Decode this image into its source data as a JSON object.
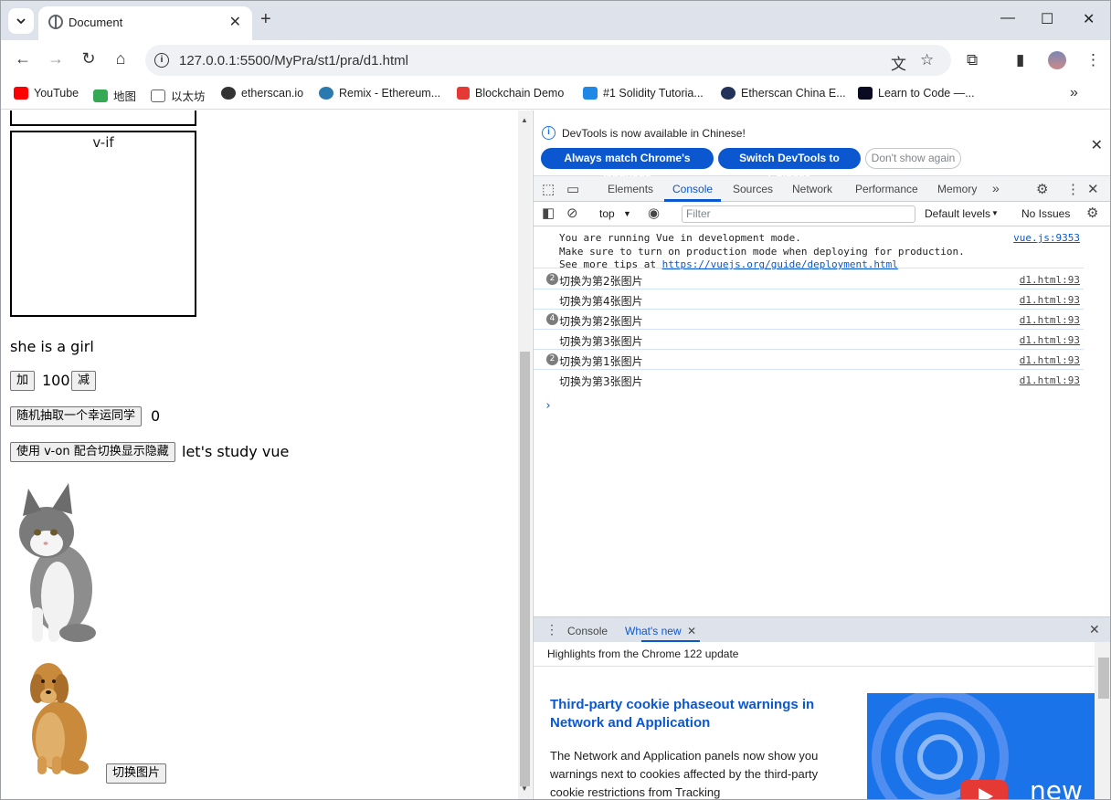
{
  "browser": {
    "tab_title": "Document",
    "url": "127.0.0.1:5500/MyPra/st1/pra/d1.html",
    "bookmarks": [
      {
        "label": "YouTube",
        "color": "#ff0000"
      },
      {
        "label": "地图",
        "color": "#34a853"
      },
      {
        "label": "以太坊",
        "color": "#5f6368"
      },
      {
        "label": "etherscan.io",
        "color": "#333333"
      },
      {
        "label": "Remix - Ethereum...",
        "color": "#2a7ab0"
      },
      {
        "label": "Blockchain Demo",
        "color": "#e53935"
      },
      {
        "label": "#1 Solidity Tutoria...",
        "color": "#1e88e5"
      },
      {
        "label": "Etherscan China E...",
        "color": "#21325b"
      },
      {
        "label": "Learn to Code —...",
        "color": "#0a0a23"
      }
    ]
  },
  "page": {
    "vif_label": "v-if",
    "she_text": "she is a girl",
    "add_btn": "加",
    "counter": "100",
    "sub_btn": "减",
    "random_btn": "随机抽取一个幸运同学",
    "random_value": "0",
    "toggle_btn": "使用 v-on 配合切换显示隐藏",
    "toggle_text": "let's study vue",
    "switch_btn": "切换图片"
  },
  "devtools": {
    "info_msg": "DevTools is now available in Chinese!",
    "btn_match": "Always match Chrome's language",
    "btn_switch": "Switch DevTools to Chinese",
    "btn_dont": "Don't show again",
    "tabs": [
      "Elements",
      "Console",
      "Sources",
      "Network",
      "Performance",
      "Memory"
    ],
    "active_tab": "Console",
    "context": "top",
    "filter_placeholder": "Filter",
    "levels": "Default levels",
    "issues": "No Issues",
    "vue_line1": "You are running Vue in development mode.",
    "vue_line2": "Make sure to turn on production mode when deploying for production.",
    "vue_line3": "See more tips at ",
    "vue_link": "https://vuejs.org/guide/deployment.html",
    "vue_src": "vue.js:9353",
    "logs": [
      {
        "count": "2",
        "text": "切换为第2张图片",
        "src": "d1.html:93"
      },
      {
        "count": "",
        "text": "切换为第4张图片",
        "src": "d1.html:93"
      },
      {
        "count": "4",
        "text": "切换为第2张图片",
        "src": "d1.html:93"
      },
      {
        "count": "",
        "text": "切换为第3张图片",
        "src": "d1.html:93"
      },
      {
        "count": "2",
        "text": "切换为第1张图片",
        "src": "d1.html:93"
      },
      {
        "count": "",
        "text": "切换为第3张图片",
        "src": "d1.html:93"
      }
    ],
    "drawer_tabs": [
      "Console",
      "What's new"
    ],
    "drawer_active": "What's new",
    "highlights": "Highlights from the Chrome 122 update",
    "wn_title": "Third-party cookie phaseout warnings in Network and Application",
    "wn_desc": "The Network and Application panels now show you warnings next to cookies affected by the third-party cookie restrictions from Tracking",
    "wn_badge": "new"
  }
}
